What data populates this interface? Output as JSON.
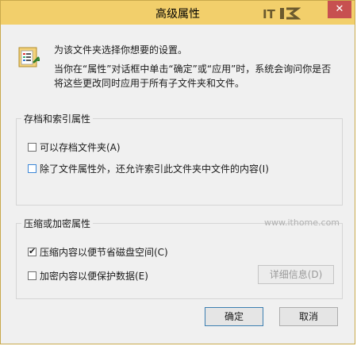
{
  "window": {
    "title": "高级属性",
    "close_glyph": "✕",
    "watermark_logo": "IT之家"
  },
  "intro": "为该文件夹选择你想要的设置。",
  "description": "当你在“属性”对话框中单击“确定”或“应用”时，系统会询问你是否将这些更改同时应用于所有子文件夹和文件。",
  "archive_group": {
    "label": "存档和索引属性",
    "options": [
      {
        "label": "可以存档文件夹(A)",
        "checked": false
      },
      {
        "label": "除了文件属性外，还允许索引此文件夹中文件的内容(I)",
        "checked": false
      }
    ]
  },
  "compress_group": {
    "label": "压缩或加密属性",
    "options": [
      {
        "label": "压缩内容以便节省磁盘空间(C)",
        "checked": true
      },
      {
        "label": "加密内容以便保护数据(E)",
        "checked": false
      }
    ],
    "details_button": "详细信息(D)"
  },
  "watermark_url": "www.ithome.com",
  "footer": {
    "ok": "确定",
    "cancel": "取消"
  },
  "colors": {
    "titlebar": "#f2cf6b",
    "close": "#c75050",
    "focus_blue": "#3c86d6"
  },
  "icons": {
    "folder": "folder-settings-icon",
    "close": "close-icon",
    "check": "checkmark-icon"
  }
}
